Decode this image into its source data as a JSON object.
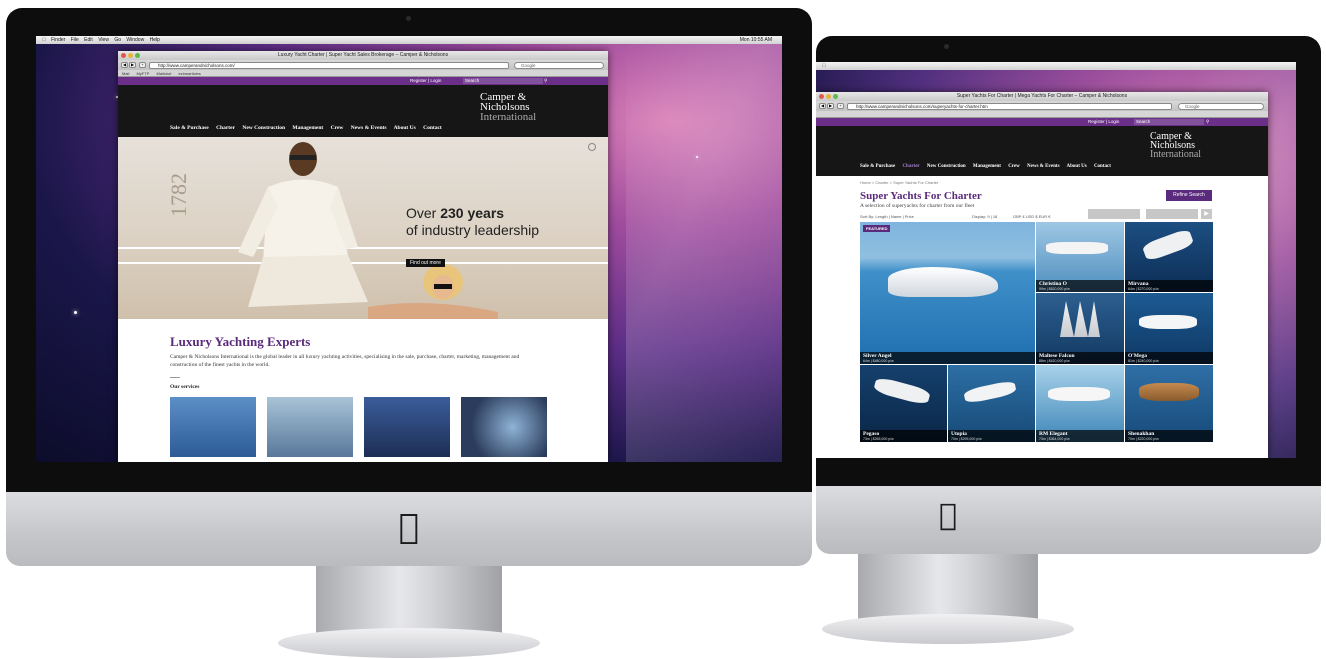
{
  "left_imac": {
    "menubar": {
      "items": [
        "Finder",
        "File",
        "Edit",
        "View",
        "Go",
        "Window",
        "Help"
      ],
      "clock": "Mon 10:55 AM"
    },
    "browser": {
      "title": "Luxury Yacht Charter | Super Yacht Sales Brokerage – Camper & Nicholsons",
      "url": "http://www.camperandnicholsons.com/",
      "search_placeholder": "Google",
      "bookmarks": [
        "Mail",
        "MyFTP",
        "Mailshot",
        "ezinearticles"
      ]
    },
    "site": {
      "top_links": "Register | Login",
      "search_label": "Search",
      "logo_line1": "Camper &",
      "logo_line2": "Nicholsons",
      "logo_line3": "International",
      "nav": [
        "Sale & Purchase",
        "Charter",
        "New Construction",
        "Management",
        "Crew",
        "News & Events",
        "About Us",
        "Contact"
      ],
      "hero_year": "1782",
      "hero_line1_pre": "Over ",
      "hero_line1_bold": "230 years",
      "hero_line2": "of industry leadership",
      "hero_button": "Find out more",
      "section_title": "Luxury Yachting Experts",
      "section_text": "Camper & Nicholsons International is the global leader in all luxury yachting activities, specialising in the sale, purchase, charter, marketing, management and construction of the finest yachts in the world.",
      "services_label": "Our services"
    }
  },
  "right_imac": {
    "browser": {
      "title": "Super Yachts For Charter | Mega Yachts For Charter – Camper & Nicholsons",
      "url": "http://www.camperandnicholsons.com/superyachts-for-charter.htm",
      "search_placeholder": "Google"
    },
    "site": {
      "top_links": "Register | Login",
      "search_label": "Search",
      "logo_line1": "Camper &",
      "logo_line2": "Nicholsons",
      "logo_line3": "International",
      "nav": [
        "Sale & Purchase",
        "Charter",
        "New Construction",
        "Management",
        "Crew",
        "News & Events",
        "About Us",
        "Contact"
      ],
      "active_nav": "Charter",
      "breadcrumb": "Home  >  Charter  >  Super Yachts For Charter",
      "page_title": "Super Yachts For Charter",
      "subtitle": "A selection of superyachts for charter from our fleet",
      "refine_button": "Refine Search",
      "sort_text": "Sort By:  Length  |  Name  |  Price",
      "display_text": "Display:  9  |  18",
      "currency_text": "GBP £   USD $   EUR €",
      "featured_badge": "FEATURED",
      "yachts": [
        {
          "name": "Silver Angel",
          "detail": "64m  |  $480,000 p/w"
        },
        {
          "name": "Christina O",
          "detail": "99m  |  $620,000 p/w"
        },
        {
          "name": "Mirvana",
          "detail": "64m  |  $270,000 p/w"
        },
        {
          "name": "Maltese Falcon",
          "detail": "88m  |  $420,000 p/w"
        },
        {
          "name": "O'Mega",
          "detail": "81m  |  $240,000 p/w"
        },
        {
          "name": "Pegaso",
          "detail": "73m  |  $265,000 p/w"
        },
        {
          "name": "Utopia",
          "detail": "70m  |  $295,000 p/w"
        },
        {
          "name": "RM Elegant",
          "detail": "73m  |  $364,000 p/w"
        },
        {
          "name": "Shenakhan",
          "detail": "70m  |  $220,000 p/w"
        }
      ]
    }
  }
}
